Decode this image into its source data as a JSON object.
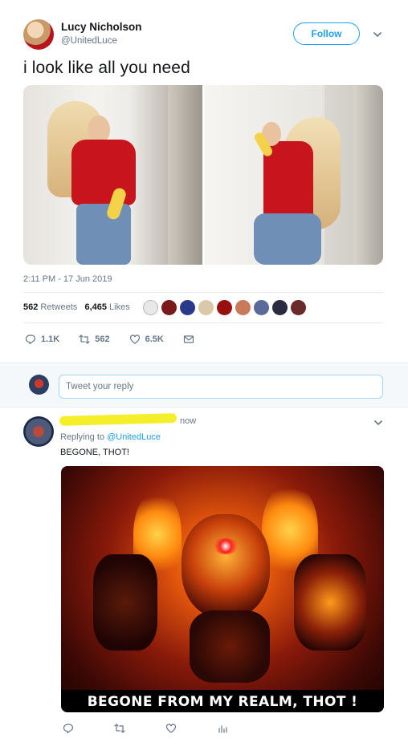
{
  "tweet": {
    "author_name": "Lucy Nicholson",
    "author_handle": "@UnitedLuce",
    "follow_label": "Follow",
    "text": "i look like all you need",
    "timestamp": "2:11 PM - 17 Jun 2019",
    "retweets_count": "562",
    "retweets_label": "Retweets",
    "likes_count": "6,465",
    "likes_label": "Likes",
    "actions": {
      "reply_count": "1.1K",
      "retweet_count": "562",
      "like_count": "6.5K"
    }
  },
  "reply_box": {
    "placeholder": "Tweet your reply"
  },
  "reply": {
    "time": "now",
    "replying_to_prefix": "Replying to",
    "replying_to_handle": "@UnitedLuce",
    "text": "BEGONE, THOT!",
    "meme_caption": "BEGONE FROM MY REALM, THOT !"
  },
  "colors": {
    "accent": "#1da1f2",
    "muted": "#657786",
    "redaction": "#f5ee2a"
  },
  "icons": [
    "chevron-down-icon",
    "reply-icon",
    "retweet-icon",
    "like-icon",
    "dm-icon",
    "analytics-icon"
  ]
}
